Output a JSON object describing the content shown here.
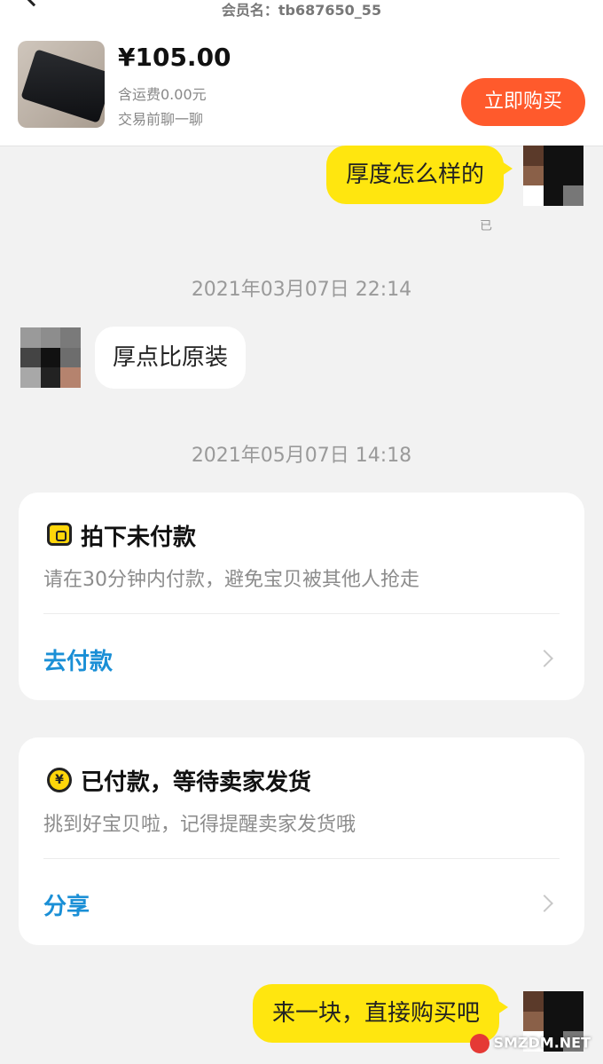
{
  "header": {
    "member": "会员名：tb687650_55",
    "price": "¥105.00",
    "shipping": "含运费0.00元",
    "chat_first": "交易前聊一聊",
    "buy_label": "立即购买"
  },
  "messages": {
    "m1": "厚度怎么样的",
    "m1_status": "已",
    "ts1": "2021年03月07日 22:14",
    "m2": "厚点比原装",
    "ts2": "2021年05月07日 14:18",
    "m3": "来一块，直接购买吧"
  },
  "cards": [
    {
      "icon": "wallet-icon",
      "title": "拍下未付款",
      "desc": "请在30分钟内付款，避免宝贝被其他人抢走",
      "action": "去付款"
    },
    {
      "icon": "coin-icon",
      "coin_symbol": "¥",
      "title": "已付款，等待卖家发货",
      "desc": "挑到好宝贝啦，记得提醒卖家发货哦",
      "action": "分享"
    }
  ],
  "watermark": "SMZDM.NET",
  "colors": {
    "accent": "#ff5a2c",
    "bubble_mine": "#ffe60f",
    "link": "#1a8fd6"
  }
}
